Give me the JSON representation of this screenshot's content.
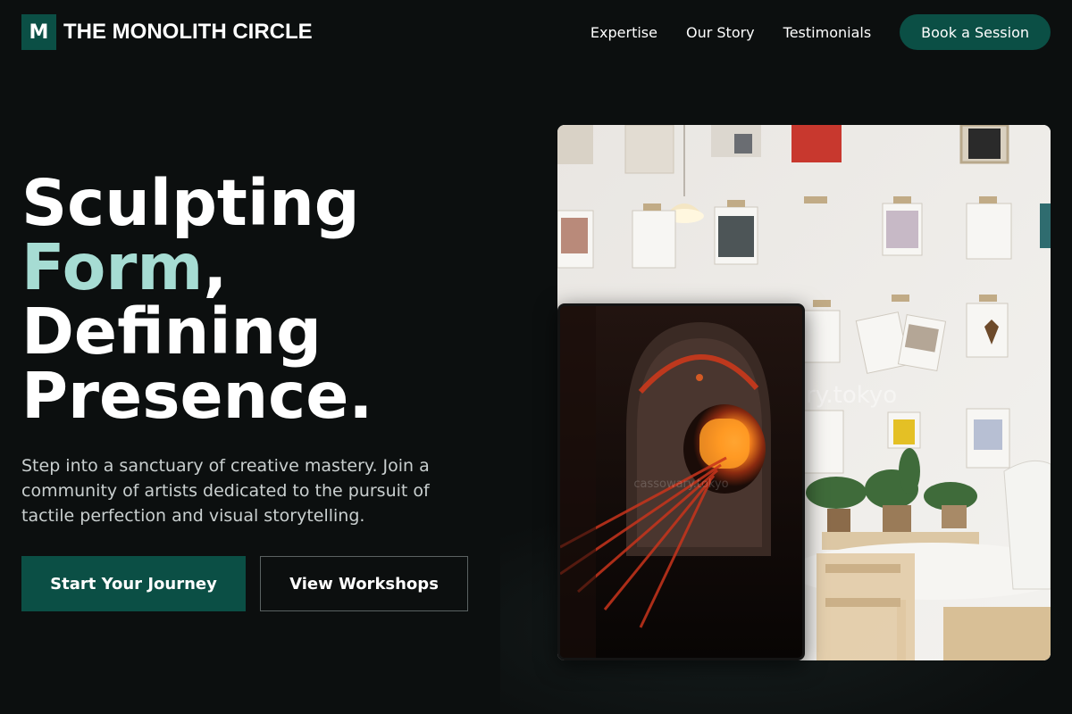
{
  "brand": {
    "mark": "M",
    "name": "THE MONOLITH CIRCLE"
  },
  "nav": {
    "links": [
      "Expertise",
      "Our Story",
      "Testimonials"
    ],
    "cta": "Book a Session"
  },
  "hero": {
    "title_line1": "Sculpting",
    "title_accent": "Form",
    "title_comma": ",",
    "title_line3": "Defining",
    "title_line4": "Presence.",
    "subtitle": "Step into a sanctuary of creative mastery. Join a community of artists dedicated to the pursuit of tactile perfection and visual storytelling.",
    "primary_button": "Start Your Journey",
    "secondary_button": "View Workshops"
  },
  "images": {
    "main_watermark": "ry.tokyo",
    "inset_watermark": "cassowary.tokyo"
  },
  "colors": {
    "background": "#0c0f0f",
    "brand_green": "#0b4f45",
    "accent_mint": "#a6dcd3"
  }
}
